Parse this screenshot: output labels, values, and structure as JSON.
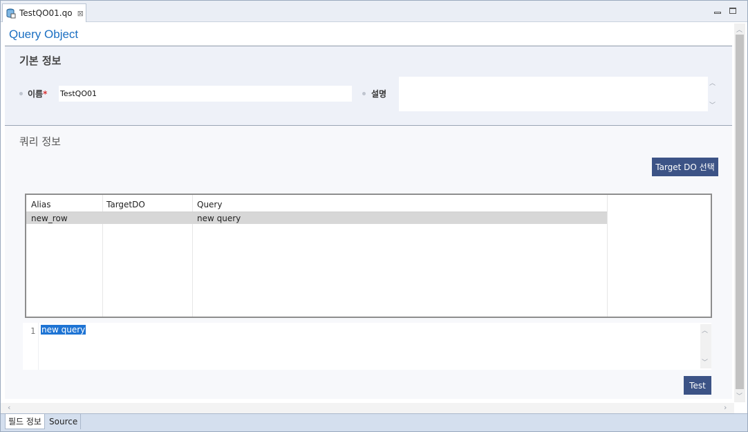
{
  "tab": {
    "title": "TestQO01.qo",
    "close_glyph": "⊠"
  },
  "window": {
    "minimize_glyph": "▭"
  },
  "page": {
    "title": "Query Object"
  },
  "basic_info": {
    "heading": "기본 정보",
    "name_label": "이름",
    "required_mark": "*",
    "name_value": "TestQO01",
    "desc_label": "설명",
    "desc_value": ""
  },
  "query_info": {
    "heading": "쿼리 정보",
    "select_button": "Target DO 선택",
    "table": {
      "columns": [
        "Alias",
        "TargetDO",
        "Query"
      ],
      "rows": [
        {
          "alias": "new_row",
          "target_do": "",
          "query": "new query"
        }
      ]
    },
    "editor": {
      "line_number": "1",
      "text": "new query"
    },
    "test_button": "Test"
  },
  "bottom_tabs": [
    {
      "label": "필드 정보",
      "active": true
    },
    {
      "label": "Source",
      "active": false
    }
  ],
  "colors": {
    "accent": "#1b6fc2",
    "button": "#3c5386",
    "selection": "#1e74d4"
  },
  "icons": [
    "database-file-icon",
    "close-icon",
    "minimize-icon",
    "maximize-icon",
    "chevron-up-icon",
    "chevron-down-icon",
    "chevron-left-icon",
    "chevron-right-icon"
  ]
}
